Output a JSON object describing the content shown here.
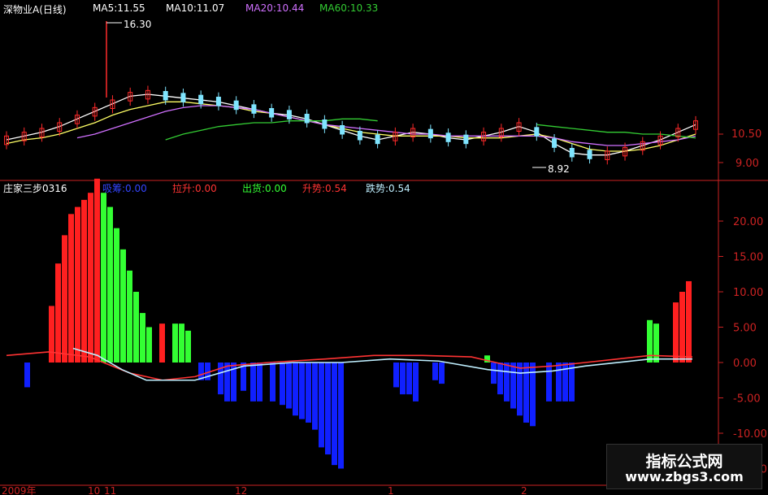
{
  "top_header": {
    "name": "深物业A(日线)",
    "ma5": "MA5:11.55",
    "ma10": "MA10:11.07",
    "ma20": "MA20:10.44",
    "ma60": "MA60:10.33"
  },
  "bottom_header": {
    "indicator": "庄家三步0316",
    "s1": "吸筹:0.00",
    "s2": "拉升:0.00",
    "s3": "出货:0.00",
    "s4": "升势:0.54",
    "s5": "跌势:0.54"
  },
  "colors": {
    "background": "#000000",
    "up": "#ff2a2a",
    "down": "#7fe5ff",
    "ma5": "#ffffff",
    "ma10": "#ffff66",
    "ma20": "#d070ff",
    "ma60": "#33cc33",
    "axis": "#cc2222",
    "bar_red": "#ff2020",
    "bar_green": "#33ff33",
    "bar_blue": "#1020ff",
    "line_cyan": "#bfefff",
    "line_red": "#ff3333"
  },
  "annotations": {
    "high": "16.30",
    "low": "8.92"
  },
  "x_labels": [
    "2009年",
    "10",
    "11",
    "12",
    "1",
    "2"
  ],
  "watermark": {
    "title": "指标公式网",
    "url": "www.zbgs3.com"
  },
  "chart_data": [
    {
      "type": "candlestick",
      "y_ticks": [
        "10.50",
        "9.00"
      ],
      "annotations": [
        "16.30",
        "8.92"
      ],
      "series": [
        {
          "name": "MA5",
          "values": [
            10.2,
            10.4,
            10.6,
            10.9,
            11.3,
            11.7,
            12.1,
            12.5,
            12.6,
            12.5,
            12.4,
            12.3,
            12.2,
            12.0,
            11.8,
            11.6,
            11.5,
            11.3,
            11.0,
            10.7,
            10.4,
            10.2,
            10.4,
            10.6,
            10.5,
            10.3,
            10.2,
            10.4,
            10.6,
            10.9,
            10.6,
            10.0,
            9.5,
            9.4,
            9.4,
            9.6,
            9.9,
            10.2,
            10.6,
            11.0
          ]
        },
        {
          "name": "MA10",
          "values": [
            10.0,
            10.2,
            10.3,
            10.5,
            10.8,
            11.1,
            11.5,
            11.8,
            12.0,
            12.2,
            12.2,
            12.1,
            12.0,
            11.9,
            11.7,
            11.6,
            11.4,
            11.2,
            11.0,
            10.8,
            10.6,
            10.5,
            10.4,
            10.4,
            10.4,
            10.4,
            10.3,
            10.3,
            10.3,
            10.4,
            10.5,
            10.3,
            10.0,
            9.7,
            9.6,
            9.6,
            9.7,
            9.9,
            10.2,
            10.5
          ]
        },
        {
          "name": "MA20",
          "values": [
            null,
            null,
            null,
            null,
            10.3,
            10.5,
            10.8,
            11.1,
            11.4,
            11.7,
            11.9,
            12.0,
            12.0,
            11.9,
            11.8,
            11.6,
            11.4,
            11.2,
            11.0,
            10.9,
            10.8,
            10.7,
            10.6,
            10.5,
            10.5,
            10.4,
            10.4,
            10.4,
            10.4,
            10.4,
            10.4,
            10.3,
            10.1,
            10.0,
            9.9,
            9.9,
            10.0,
            10.1,
            10.2,
            10.4
          ]
        },
        {
          "name": "MA60",
          "values": [
            null,
            null,
            null,
            null,
            null,
            null,
            null,
            null,
            null,
            10.2,
            10.5,
            10.7,
            10.9,
            11.0,
            11.1,
            11.1,
            11.2,
            11.2,
            11.2,
            11.3,
            11.3,
            11.2,
            null,
            null,
            null,
            null,
            null,
            null,
            null,
            null,
            11.0,
            10.9,
            10.8,
            10.7,
            10.6,
            10.6,
            10.5,
            10.5,
            10.4,
            10.3
          ]
        }
      ]
    },
    {
      "type": "bar",
      "title": "庄家三步0316",
      "y_ticks": [
        20.0,
        15.0,
        10.0,
        5.0,
        0.0,
        -5.0,
        -10.0,
        -15.0
      ],
      "series": [
        {
          "name": "拉升",
          "color": "red",
          "bars": [
            [
              60,
              8
            ],
            [
              68,
              14
            ],
            [
              76,
              18
            ],
            [
              84,
              21
            ],
            [
              92,
              22
            ],
            [
              100,
              23
            ],
            [
              108,
              24
            ],
            [
              116,
              26
            ],
            [
              196,
              5.5
            ]
          ]
        },
        {
          "name": "出货",
          "color": "green",
          "bars": [
            [
              124,
              24
            ],
            [
              132,
              22
            ],
            [
              140,
              19
            ],
            [
              148,
              16
            ],
            [
              156,
              13
            ],
            [
              164,
              10
            ],
            [
              172,
              7
            ],
            [
              180,
              5
            ],
            [
              212,
              5.5
            ],
            [
              220,
              5.5
            ],
            [
              228,
              4.5
            ],
            [
              596,
              1
            ],
            [
              796,
              6
            ],
            [
              804,
              5.5
            ]
          ]
        },
        {
          "name": "红柱",
          "color": "red",
          "bars": [
            [
              828,
              8.5
            ],
            [
              836,
              10
            ],
            [
              844,
              11.5
            ]
          ]
        },
        {
          "name": "吸筹",
          "color": "blue",
          "bars": [
            [
              30,
              -3.5
            ],
            [
              244,
              -2.5
            ],
            [
              252,
              -2.5
            ],
            [
              268,
              -4.5
            ],
            [
              276,
              -5.5
            ],
            [
              284,
              -5.5
            ],
            [
              296,
              -4
            ],
            [
              308,
              -5.5
            ],
            [
              316,
              -5.5
            ],
            [
              332,
              -5.5
            ],
            [
              344,
              -6
            ],
            [
              352,
              -6.5
            ],
            [
              360,
              -7.5
            ],
            [
              368,
              -8
            ],
            [
              376,
              -8.5
            ],
            [
              384,
              -9.5
            ],
            [
              392,
              -12
            ],
            [
              400,
              -13
            ],
            [
              408,
              -14.5
            ],
            [
              416,
              -15
            ],
            [
              484,
              -3.5
            ],
            [
              492,
              -4.5
            ],
            [
              500,
              -4.5
            ],
            [
              508,
              -5.5
            ],
            [
              532,
              -2.5
            ],
            [
              540,
              -3
            ],
            [
              604,
              -3
            ],
            [
              612,
              -4.5
            ],
            [
              620,
              -5.5
            ],
            [
              628,
              -6.5
            ],
            [
              636,
              -7.5
            ],
            [
              644,
              -8.5
            ],
            [
              652,
              -9
            ],
            [
              672,
              -5.5
            ],
            [
              684,
              -5.5
            ],
            [
              692,
              -5.5
            ],
            [
              700,
              -5.5
            ]
          ]
        },
        {
          "name": "升势",
          "color": "red-line",
          "values": [
            [
              8,
              1
            ],
            [
              60,
              1.5
            ],
            [
              110,
              0.8
            ],
            [
              160,
              -1.5
            ],
            [
              200,
              -2.5
            ],
            [
              240,
              -2
            ],
            [
              280,
              -0.5
            ],
            [
              330,
              0
            ],
            [
              400,
              0.5
            ],
            [
              460,
              1
            ],
            [
              520,
              1
            ],
            [
              580,
              0.8
            ],
            [
              610,
              0
            ],
            [
              640,
              -0.8
            ],
            [
              680,
              -0.5
            ],
            [
              720,
              0
            ],
            [
              760,
              0.5
            ],
            [
              800,
              1
            ],
            [
              852,
              0.8
            ]
          ]
        },
        {
          "name": "跌势",
          "color": "cyan-line",
          "values": [
            [
              90,
              2
            ],
            [
              120,
              1
            ],
            [
              150,
              -1
            ],
            [
              180,
              -2.5
            ],
            [
              240,
              -2.5
            ],
            [
              300,
              -0.5
            ],
            [
              360,
              0
            ],
            [
              420,
              0
            ],
            [
              480,
              0.5
            ],
            [
              540,
              0.2
            ],
            [
              600,
              -1
            ],
            [
              640,
              -1.5
            ],
            [
              680,
              -1.2
            ],
            [
              720,
              -0.5
            ],
            [
              800,
              0.5
            ],
            [
              852,
              0.5
            ]
          ]
        }
      ]
    }
  ]
}
